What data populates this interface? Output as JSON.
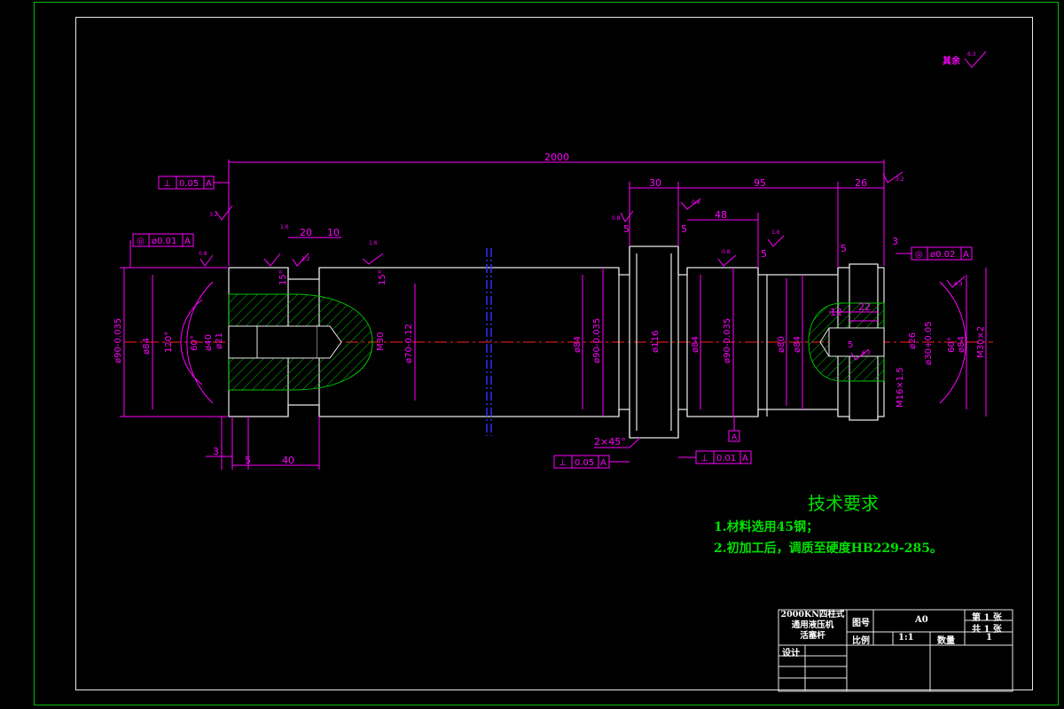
{
  "drawing": {
    "overall_length": "2000",
    "surface_finish_other": "其余",
    "surface_finish_other_value": "6.3",
    "datum_label": "A"
  },
  "dimensions": {
    "top": [
      "30",
      "95",
      "26",
      "48",
      "20",
      "10",
      "5",
      "5",
      "5",
      "3",
      "12",
      "22",
      "5"
    ],
    "bottom": [
      "3",
      "5",
      "40",
      "2×45°"
    ],
    "diameters_left": [
      "ø90-0.035",
      "ø84",
      "120°",
      "60°",
      "ø40",
      "ø21",
      "M30",
      "ø70-0.12",
      "15°",
      "15°"
    ],
    "diameters_mid": [
      "ø84",
      "ø90-0.035",
      "ø116",
      "ø84",
      "ø90-0.035",
      "ø80"
    ],
    "diameters_right": [
      "ø84",
      "ø26",
      "ø30+0.05",
      "60°",
      "ø84",
      "M30×2",
      "M16×1.5",
      "5"
    ]
  },
  "tolerances": {
    "left_top": {
      "symbol": "⊥",
      "value": "0.05",
      "datum": "A"
    },
    "left_concentric": {
      "symbol": "◎",
      "value": "ø0.01",
      "datum": "A"
    },
    "right_concentric": {
      "symbol": "◎",
      "value": "ø0.02",
      "datum": "A"
    },
    "bottom_left": {
      "symbol": "⊥",
      "value": "0.05",
      "datum": "A"
    },
    "bottom_right": {
      "symbol": "⊥",
      "value": "0.01",
      "datum": "A"
    }
  },
  "roughness": [
    "3.2",
    "0.8",
    "1.6",
    "0.8",
    "1.6",
    "0.8",
    "0.8",
    "3.2",
    "3.2",
    "1.6",
    "6.3",
    "6.3"
  ],
  "tech_requirements": {
    "title": "技术要求",
    "items": [
      "1.材料选用45钢；",
      "2.初加工后，调质至硬度HB229-285。"
    ]
  },
  "title_block": {
    "part_name_lines": [
      "2000KN四柱式",
      "通用液压机",
      "活塞杆"
    ],
    "drawing_no_label": "图号",
    "drawing_no_value": "A0",
    "scale_label": "比例",
    "scale_value": "1:1",
    "qty_label": "数量",
    "qty_value": "1",
    "sheet_label": "第 1 张",
    "total_label": "共 1 张",
    "designer_label": "设计"
  },
  "colors": {
    "dimension": "#ff00ff",
    "outline": "#e8e8e8",
    "center_line": "#ff2020",
    "hatch": "#00c000",
    "break_line": "#3030ff",
    "text_green": "#00e000"
  }
}
